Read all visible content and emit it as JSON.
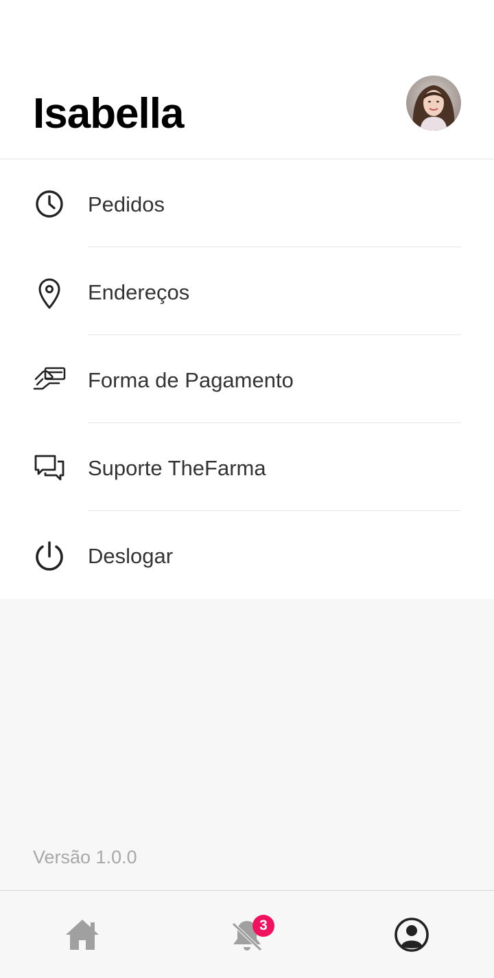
{
  "user": {
    "name": "Isabella"
  },
  "menu": {
    "items": [
      {
        "label": "Pedidos",
        "icon": "clock-icon"
      },
      {
        "label": "Endereços",
        "icon": "location-pin-icon"
      },
      {
        "label": "Forma de Pagamento",
        "icon": "hand-card-icon"
      },
      {
        "label": "Suporte TheFarma",
        "icon": "chat-bubbles-icon"
      },
      {
        "label": "Deslogar",
        "icon": "power-icon"
      }
    ]
  },
  "footer": {
    "version": "Versão 1.0.0"
  },
  "bottom_nav": {
    "items": [
      {
        "icon": "home-icon"
      },
      {
        "icon": "bell-off-icon",
        "badge": "3"
      },
      {
        "icon": "profile-icon"
      }
    ]
  },
  "colors": {
    "badge": "#f0115f",
    "nav_inactive": "#a0a0a0",
    "nav_active": "#222222"
  }
}
